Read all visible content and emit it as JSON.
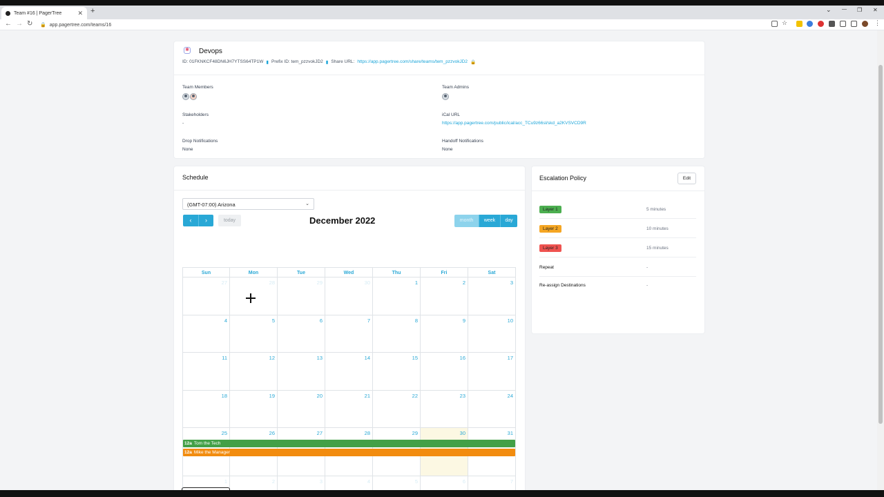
{
  "browser": {
    "tab_title": "Team #16 | PagerTree",
    "tab_close": "✕",
    "new_tab": "+",
    "url": "app.pagertree.com/teams/16",
    "back": "←",
    "forward": "→",
    "reload": "↻",
    "minimize": "—",
    "maximize": "❐",
    "close": "✕",
    "dropdown": "⌄"
  },
  "team": {
    "name": "Devops",
    "id_text": "ID: 01FKNKCF48DN6JH7YTSS64TP1W",
    "prefix_text": "Prefix ID: tem_pzzvokJD2",
    "share_label": "Share URL:",
    "share_url": "https://app.pagertree.com/share/teams/tem_pzzvokJD2",
    "members_label": "Team Members",
    "admins_label": "Team Admins",
    "stakeholders_label": "Stakeholders",
    "stakeholders_value": "-",
    "ical_label": "iCal URL",
    "ical_url": "https://app.pagertree.com/public/ical/acc_TCu9z66sl/skd_a2KVSVCD9R",
    "drop_label": "Drop Notifications",
    "drop_value": "None",
    "handoff_label": "Handoff Notifications",
    "handoff_value": "None"
  },
  "schedule": {
    "title": "Schedule",
    "timezone": "(GMT-07:00) Arizona",
    "prev": "‹",
    "next": "›",
    "today": "today",
    "month_title": "December 2022",
    "view_month": "month",
    "view_week": "week",
    "view_day": "day",
    "day_headers": [
      "Sun",
      "Mon",
      "Tue",
      "Wed",
      "Thu",
      "Fri",
      "Sat"
    ],
    "weeks": [
      [
        "27",
        "28",
        "29",
        "30",
        "1",
        "2",
        "3"
      ],
      [
        "4",
        "5",
        "6",
        "7",
        "8",
        "9",
        "10"
      ],
      [
        "11",
        "12",
        "13",
        "14",
        "15",
        "16",
        "17"
      ],
      [
        "18",
        "19",
        "20",
        "21",
        "22",
        "23",
        "24"
      ],
      [
        "25",
        "26",
        "27",
        "28",
        "29",
        "30",
        "31"
      ],
      [
        "1",
        "2",
        "3",
        "4",
        "5",
        "6",
        "7"
      ]
    ],
    "events": [
      {
        "time": "12a",
        "name": "Tom the Tech",
        "color": "#43a047"
      },
      {
        "time": "12a",
        "name": "Mike the Manager",
        "color": "#f28c0f"
      }
    ]
  },
  "escalation": {
    "title": "Escalation Policy",
    "edit": "Edit",
    "layers": [
      {
        "label": "Layer 1",
        "value": "5 minutes",
        "color": "#4caf50"
      },
      {
        "label": "Layer 2",
        "value": "10 minutes",
        "color": "#f5a623"
      },
      {
        "label": "Layer 3",
        "value": "15 minutes",
        "color": "#ef5350"
      }
    ],
    "repeat_label": "Repeat",
    "repeat_value": "-",
    "reassign_label": "Re-assign Destinations",
    "reassign_value": "-"
  }
}
